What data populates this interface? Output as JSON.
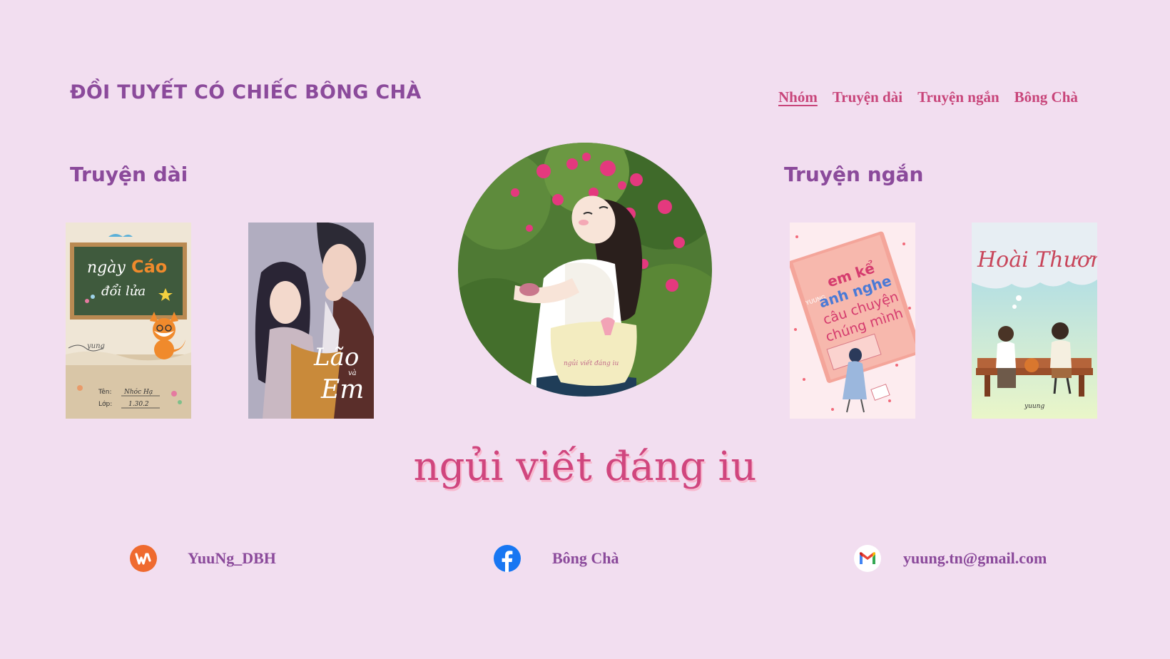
{
  "header": {
    "site_title": "ĐỒI TUYẾT CÓ CHIẾC BÔNG CHÀ",
    "nav": [
      {
        "label": "Nhóm",
        "active": true
      },
      {
        "label": "Truyện dài",
        "active": false
      },
      {
        "label": "Truyện ngắn",
        "active": false
      },
      {
        "label": "Bông Chà",
        "active": false
      }
    ]
  },
  "long_stories": {
    "title": "Truyện dài",
    "covers": [
      {
        "title_line1": "ngày",
        "title_accent": "Cáo",
        "title_line2": "đổi lửa",
        "author": "yung",
        "name_label": "Tên:",
        "name_value": "Nhóc Hạ",
        "class_label": "Lớp:",
        "class_value": "1.30.2"
      },
      {
        "title_line1": "Lão",
        "title_small": "và",
        "title_line2": "Em"
      }
    ]
  },
  "short_stories": {
    "title": "Truyện ngắn",
    "covers": [
      {
        "author": "YUUNG",
        "line1": "em kể",
        "line2": "anh nghe",
        "line3": "câu chuyện",
        "line4": "chúng mình"
      },
      {
        "title": "Hoài Thương",
        "author": "yuung"
      }
    ]
  },
  "avatar": {
    "bag_text": "ngủi viết đáng iu"
  },
  "tagline": "ngủi viết đáng iu",
  "contacts": [
    {
      "icon": "wattpad-icon",
      "label": "YuuNg_DBH",
      "color": "#ef6a2f"
    },
    {
      "icon": "facebook-icon",
      "label": "Bông Chà",
      "color": "#1877f2"
    },
    {
      "icon": "gmail-icon",
      "label": "yuung.tn@gmail.com",
      "color": "#ea4335"
    }
  ],
  "colors": {
    "background": "#f2def0",
    "heading": "#8b4a9b",
    "accent": "#c8457a",
    "tagline": "#d0467e"
  }
}
